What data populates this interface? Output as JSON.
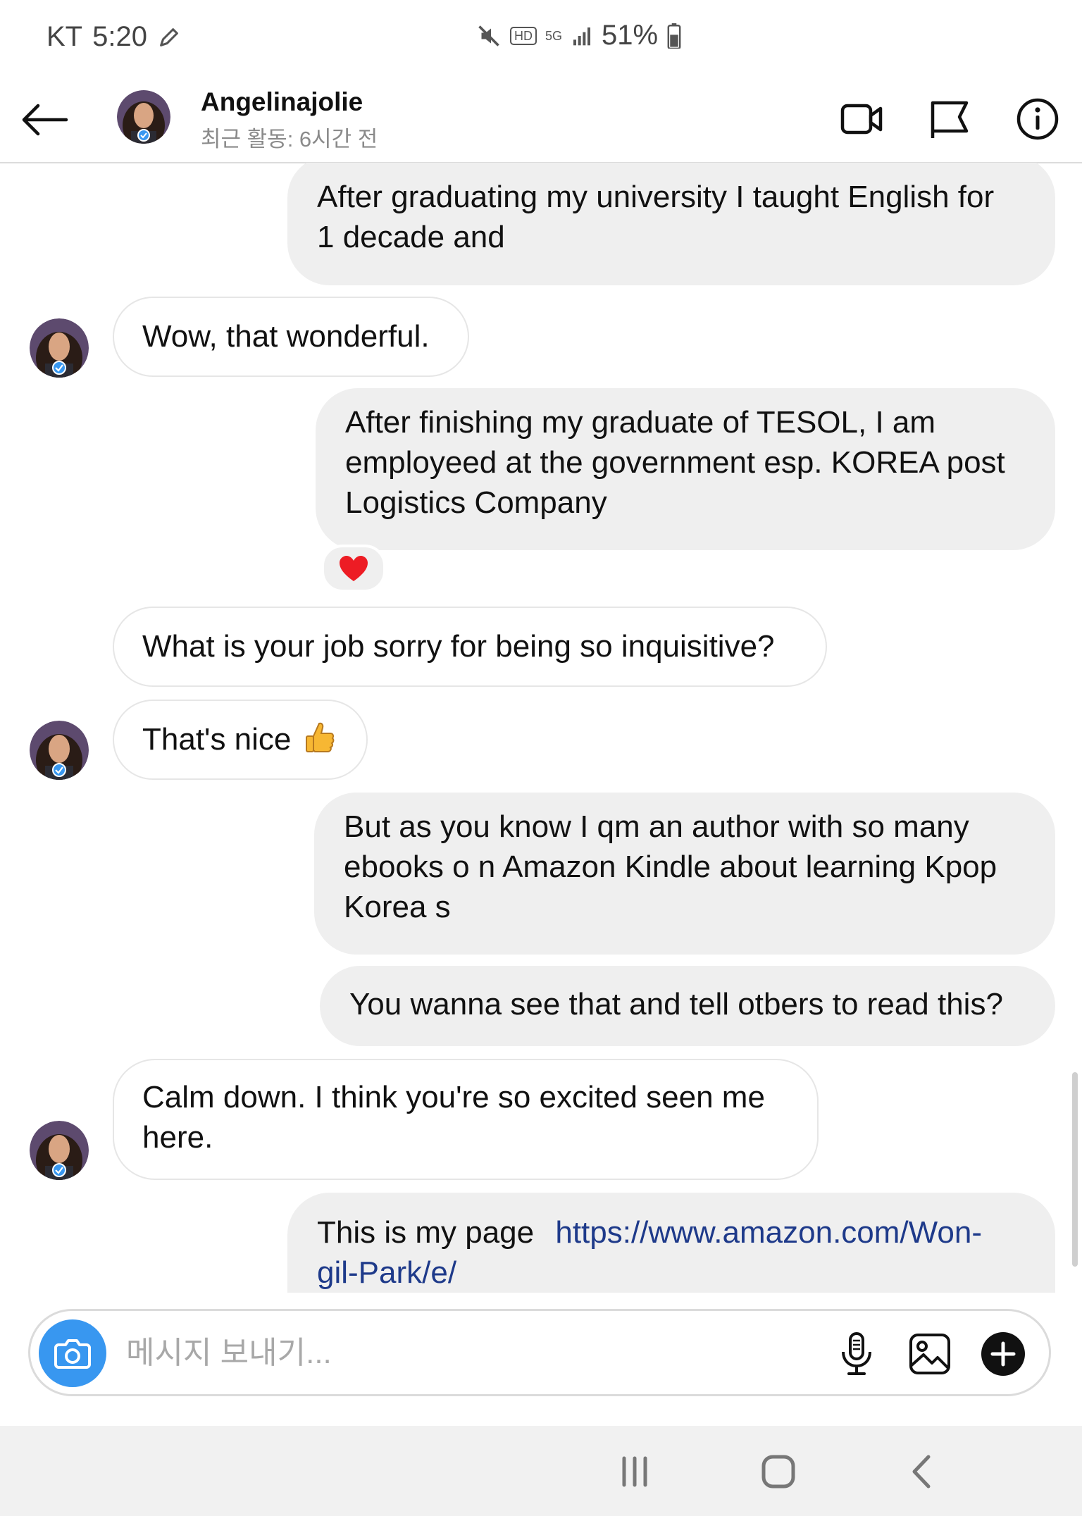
{
  "status_bar": {
    "carrier": "KT",
    "time": "5:20",
    "network": "5G",
    "hd": "HD",
    "battery": "51%"
  },
  "header": {
    "name": "Angelinajolie",
    "activity": "최근 활동: 6시간 전"
  },
  "messages": [
    {
      "direction": "outgoing",
      "lines": [
        "After graduating my university I taught English for",
        "1 decade and"
      ]
    },
    {
      "direction": "incoming",
      "lines": [
        "Wow, that wonderful."
      ]
    },
    {
      "direction": "outgoing",
      "lines": [
        "After finishing my graduate of TESOL, I am",
        "employeed at the government esp. KOREA post",
        "Logistics Company"
      ],
      "reaction": "heart"
    },
    {
      "direction": "incoming",
      "lines": [
        "What is your job sorry for being so inquisitive?"
      ]
    },
    {
      "direction": "incoming",
      "lines": [
        "That's nice"
      ],
      "emoji": "thumbs-up"
    },
    {
      "direction": "outgoing",
      "lines": [
        "But as you know I qm an author with so many",
        "ebooks o n Amazon Kindle about learning Kpop",
        "Korea s"
      ]
    },
    {
      "direction": "outgoing",
      "lines": [
        "You wanna see that and tell otbers to read this?"
      ]
    },
    {
      "direction": "incoming",
      "lines": [
        "Calm down. I think you're so excited seen me",
        "here."
      ]
    },
    {
      "direction": "outgoing",
      "text": "This is my page",
      "link_line1": "https://www.amazon.com/Won-",
      "link_line2": "gil-Park/e/"
    }
  ],
  "composer": {
    "placeholder": "메시지 보내기..."
  },
  "colors": {
    "accent": "#3897f0",
    "outgoing_bubble": "#efefef",
    "link": "#1e3a8a"
  }
}
